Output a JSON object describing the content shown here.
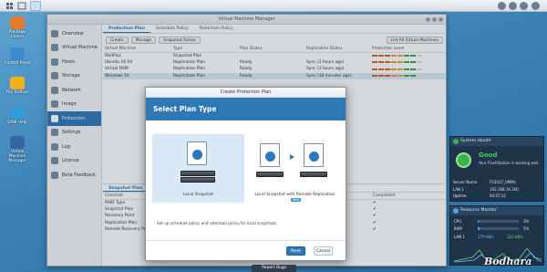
{
  "desktop": {
    "icons": [
      {
        "label": "Package Center",
        "color": "#e27b2d"
      },
      {
        "label": "Control Panel",
        "color": "#3d8bd0"
      },
      {
        "label": "File Station",
        "color": "#f2b01e"
      },
      {
        "label": "DSM Help",
        "color": "#2d9ed8"
      },
      {
        "label": "Virtual Machine Manager",
        "color": "#3465a4"
      }
    ],
    "report_bugs": "Report Bugs",
    "watermark": "Bodhara"
  },
  "window": {
    "title": "Virtual Machine Manager",
    "sidebar": [
      {
        "label": "Overview"
      },
      {
        "label": "Virtual Machine"
      },
      {
        "label": "Hosts"
      },
      {
        "label": "Storage"
      },
      {
        "label": "Network"
      },
      {
        "label": "Image"
      },
      {
        "label": "Protection",
        "active": true
      },
      {
        "label": "Settings"
      },
      {
        "label": "Log"
      },
      {
        "label": "License"
      },
      {
        "label": "Beta Feedback"
      }
    ],
    "tabs": [
      "Protection Plan",
      "Schedule Policy",
      "Retention Policy"
    ],
    "toolbar": {
      "create": "Create",
      "manage": "Manage",
      "snapshot_action": "Snapshot Action",
      "list_all": "List All Virtual Machines"
    },
    "table": {
      "headers": [
        "Virtual Machine",
        "Type",
        "Plan Status",
        "Replication Status",
        "Protection Level"
      ],
      "rows": [
        {
          "vm": "MailPlus",
          "type": "Snapshot Plan",
          "status": "",
          "replication": "",
          "level": [
            1,
            1,
            1,
            1,
            1,
            1,
            1,
            0
          ]
        },
        {
          "vm": "Ubuntu 16.04",
          "type": "Replication Plan",
          "status": "Ready",
          "replication": "Sync (2 hours ago)",
          "level": [
            1,
            1,
            1,
            1,
            1,
            1,
            1,
            0
          ]
        },
        {
          "vm": "Virtual DSM",
          "type": "Replication Plan",
          "status": "Ready",
          "replication": "Sync (2 hours ago)",
          "level": [
            1,
            1,
            1,
            1,
            1,
            1,
            1,
            0
          ]
        },
        {
          "vm": "Windows 10",
          "type": "Replication Plan",
          "status": "Ready",
          "replication": "Sync (20 minutes ago)",
          "level": [
            1,
            1,
            1,
            1,
            1,
            1,
            1,
            0
          ],
          "selected": true
        }
      ],
      "level_colors": {
        "on": "#e25a2c",
        "mid": "#f0a23a",
        "high": "#3ba84a"
      }
    },
    "detail": {
      "subtab": "Snapshot Plan",
      "headers": [
        "Checklist",
        "",
        "Completed"
      ],
      "rows": [
        {
          "label": "RAID Type",
          "done": true
        },
        {
          "label": "Snapshot Plan",
          "done": true
        },
        {
          "label": "Recovery Point",
          "done": true
        },
        {
          "label": "Replication Plan",
          "done": true
        },
        {
          "label": "Remote Recovery Point",
          "done": true
        }
      ]
    }
  },
  "dialog": {
    "title": "Create Protection Plan",
    "heading": "Select Plan Type",
    "options": [
      {
        "label": "Local Snapshot",
        "selected": true
      },
      {
        "label": "Local Snapshot with Remote Replication",
        "badge": "Beta"
      }
    ],
    "description": "Set up schedule policy and retention policy for local snapshots.",
    "next": "Next",
    "cancel": "Cancel"
  },
  "health": {
    "title": "System Health",
    "status": "Good",
    "message": "Your FlashStation is working well.",
    "fields": [
      {
        "key": "Server Name",
        "value": "FS3017_VMMs"
      },
      {
        "key": "LAN 1",
        "value": "192.168.16.160"
      },
      {
        "key": "Uptime",
        "value": "03:57:12"
      }
    ]
  },
  "resource": {
    "title": "Resource Monitor",
    "cpu_label": "CPU",
    "cpu": "3%",
    "cpu_frac": 0.03,
    "ram_label": "RAM",
    "ram": "5%",
    "ram_frac": 0.05,
    "lan_label": "LAN 1",
    "up": "179 KB/s",
    "down": "333 KB/s"
  }
}
